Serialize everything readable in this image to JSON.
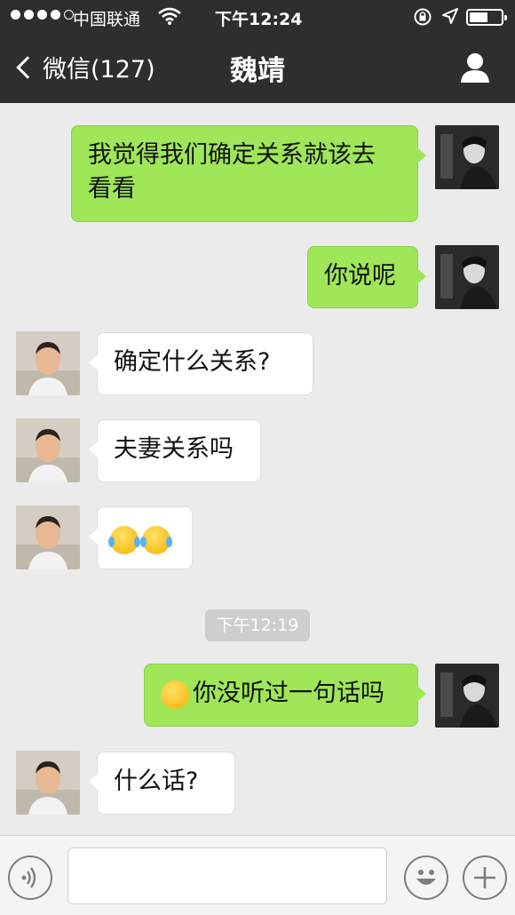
{
  "status_bar": {
    "carrier": "中国联通",
    "time": "下午12:24"
  },
  "nav": {
    "back_label": "微信(127)",
    "title": "魏靖"
  },
  "messages": [
    {
      "side": "out",
      "text": "我觉得我们确定关系就该去\n看看"
    },
    {
      "side": "out",
      "text": "你说呢"
    },
    {
      "side": "in",
      "text": "确定什么关系?"
    },
    {
      "side": "in",
      "text": "夫妻关系吗"
    },
    {
      "side": "in",
      "emoji": [
        "crying-laughing-emoji",
        "crying-laughing-emoji"
      ]
    },
    {
      "side": "out",
      "emoji": [
        "flushed-emoji"
      ],
      "text": "你没听过一句话吗"
    },
    {
      "side": "in",
      "text": "什么话?"
    }
  ],
  "timestamp": "下午12:19",
  "colors": {
    "header_bg": "#2e2e2f",
    "chat_bg": "#ebebeb",
    "outgoing_bubble": "#9fe658",
    "incoming_bubble": "#ffffff"
  },
  "icons": {
    "voice": "voice-icon",
    "emoji": "emoji-icon",
    "plus": "plus-icon",
    "contact": "person-icon"
  }
}
